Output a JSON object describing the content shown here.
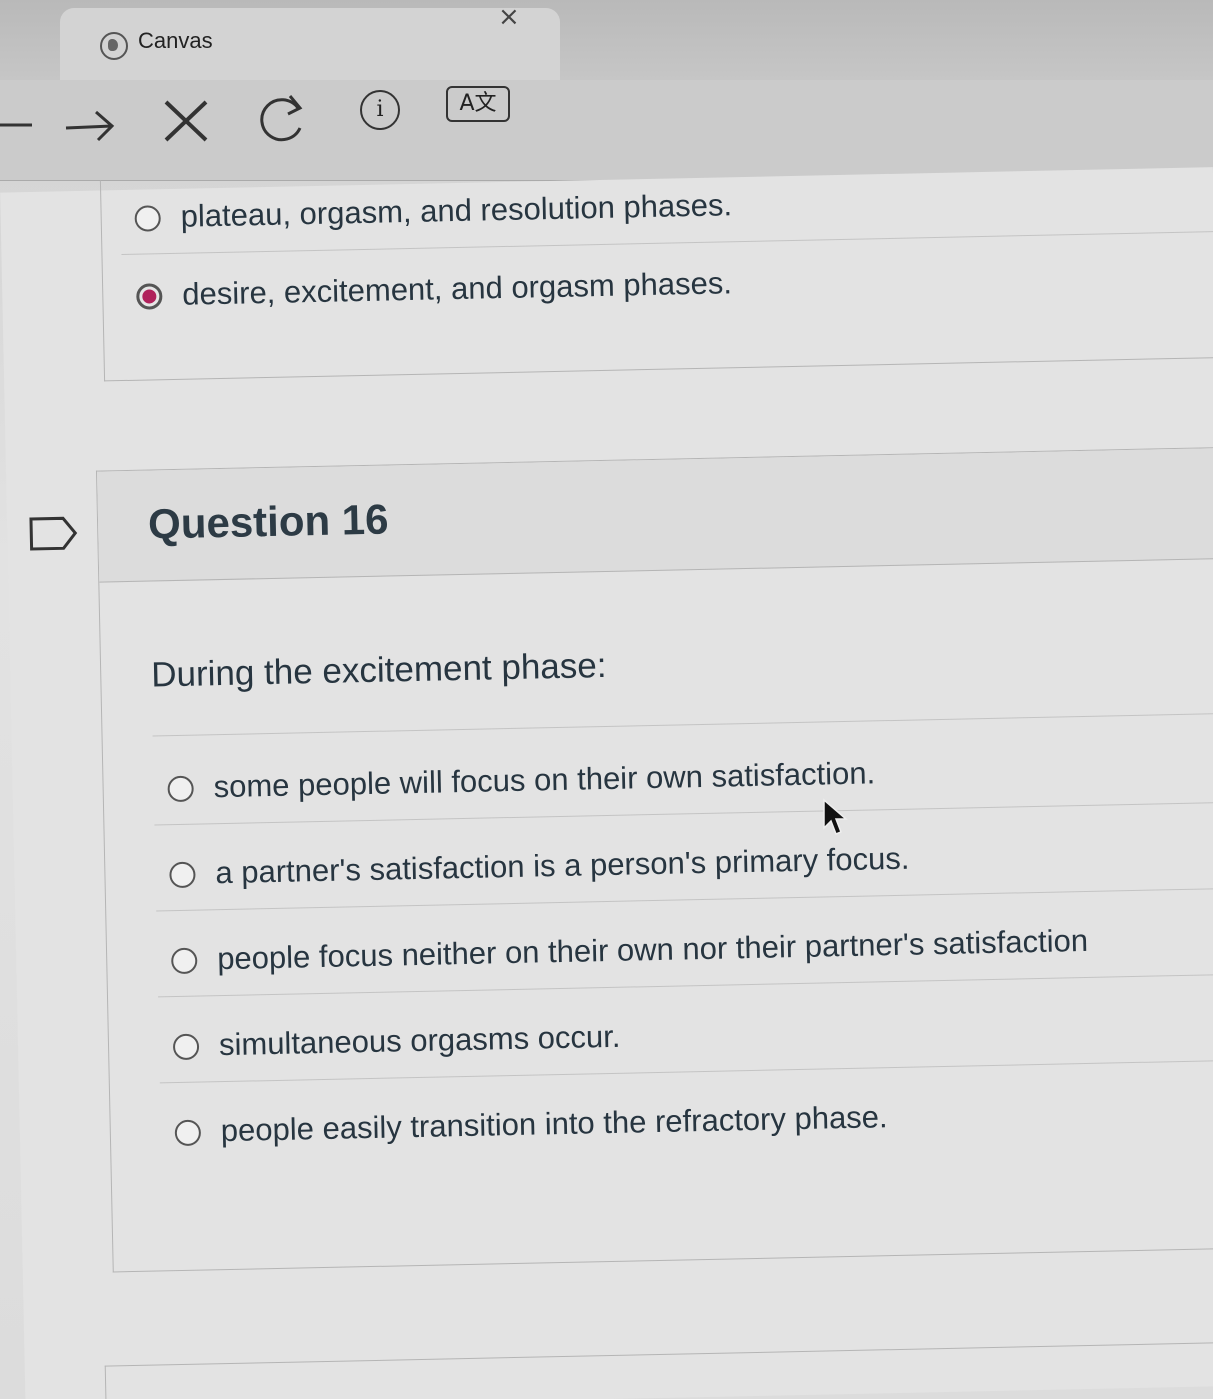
{
  "browser": {
    "tab_title": "Canvas",
    "tab_close": "×",
    "translate_label": "A文",
    "info_label": "i"
  },
  "previous_question": {
    "answers": [
      {
        "label": "plateau, orgasm, and resolution phases.",
        "selected": false
      },
      {
        "label": "desire, excitement, and orgasm phases.",
        "selected": true
      }
    ]
  },
  "question": {
    "title": "Question 16",
    "prompt": "During the excitement phase:",
    "answers": [
      {
        "label": "some people will focus on their own satisfaction.",
        "selected": false
      },
      {
        "label": "a partner's satisfaction is a person's primary focus.",
        "selected": false
      },
      {
        "label": "people focus neither on their own nor their partner's satisfaction",
        "selected": false
      },
      {
        "label": "simultaneous orgasms occur.",
        "selected": false
      },
      {
        "label": "people easily transition into the refractory phase.",
        "selected": false
      }
    ]
  },
  "colors": {
    "selected_radio": "#b0215b",
    "text": "#273540"
  }
}
